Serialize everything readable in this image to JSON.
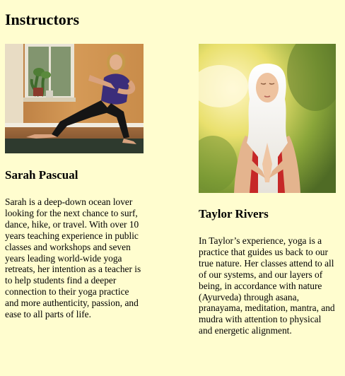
{
  "page": {
    "title": "Instructors"
  },
  "instructors": [
    {
      "name": "Sarah Pascual",
      "bio": "Sarah is a deep-down ocean lover looking for the next chance to surf, dance, hike, or travel. With over 10 years teaching experience in public classes and workshops and seven years leading world-wide yoga retreats, her intention as a teacher is to help students find a deeper connection to their yoga practice and more authenticity, passion, and ease to all parts of life."
    },
    {
      "name": "Taylor Rivers",
      "bio": "In Taylor’s experience, yoga is a practice that guides us back to our true nature. Her classes attend to all of our systems, and our layers of being, in accordance with nature (Ayurveda) through asana, pranayama, meditation, mantra, and mudra with attention to physical and energetic alignment."
    }
  ]
}
